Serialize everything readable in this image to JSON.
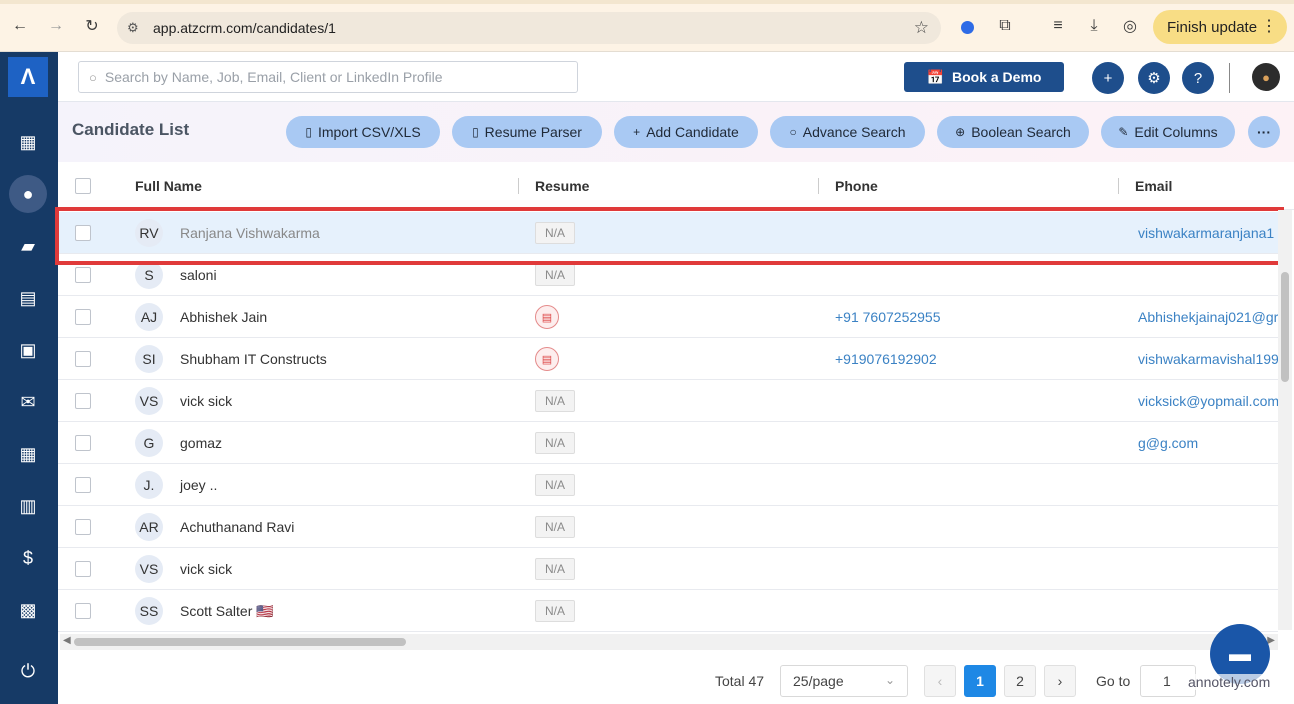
{
  "browser": {
    "url": "app.atzcrm.com/candidates/1",
    "finish_update_label": "Finish update"
  },
  "sidebar": {
    "logo_text": "Λ",
    "items": [
      {
        "name": "dashboard-icon",
        "glyph": "▦"
      },
      {
        "name": "candidates-icon",
        "glyph": "👤",
        "active": true
      },
      {
        "name": "jobs-icon",
        "glyph": "💼"
      },
      {
        "name": "clients-icon",
        "glyph": "🏬"
      },
      {
        "name": "contacts-icon",
        "glyph": "📇"
      },
      {
        "name": "mail-icon",
        "glyph": "✉"
      },
      {
        "name": "calendar-icon",
        "glyph": "📅"
      },
      {
        "name": "reports-icon",
        "glyph": "📊"
      },
      {
        "name": "billing-icon",
        "glyph": "$"
      },
      {
        "name": "payroll-icon",
        "glyph": "💵"
      },
      {
        "name": "logout-icon",
        "glyph": "⏻"
      }
    ]
  },
  "appbar": {
    "search_placeholder": "Search by Name, Job, Email, Client or LinkedIn Profile",
    "book_demo_label": "Book a Demo"
  },
  "toolbar": {
    "title": "Candidate List",
    "buttons": {
      "import": "Import CSV/XLS",
      "resume_parser": "Resume Parser",
      "add_candidate": "Add Candidate",
      "advance_search": "Advance Search",
      "boolean_search": "Boolean Search",
      "edit_columns": "Edit Columns"
    }
  },
  "table": {
    "columns": {
      "full_name": "Full Name",
      "resume": "Resume",
      "phone": "Phone",
      "email": "Email"
    },
    "na_label": "N/A",
    "rows": [
      {
        "initials": "RV",
        "name": "Ranjana Vishwakarma",
        "resume": "N/A",
        "phone": "",
        "email": "vishwakarmaranjana1"
      },
      {
        "initials": "S",
        "name": "saloni",
        "resume": "N/A",
        "phone": "",
        "email": ""
      },
      {
        "initials": "AJ",
        "name": "Abhishek Jain",
        "resume": "file",
        "phone": "+91 7607252955",
        "email": "Abhishekjainaj021@gr"
      },
      {
        "initials": "SI",
        "name": "Shubham IT Constructs",
        "resume": "file",
        "phone": "+919076192902",
        "email": "vishwakarmavishal199"
      },
      {
        "initials": "VS",
        "name": "vick sick",
        "resume": "N/A",
        "phone": "",
        "email": "vicksick@yopmail.com"
      },
      {
        "initials": "G",
        "name": "gomaz",
        "resume": "N/A",
        "phone": "",
        "email": "g@g.com"
      },
      {
        "initials": "J.",
        "name": "joey ..",
        "resume": "N/A",
        "phone": "",
        "email": ""
      },
      {
        "initials": "AR",
        "name": "Achuthanand Ravi",
        "resume": "N/A",
        "phone": "",
        "email": ""
      },
      {
        "initials": "VS",
        "name": "vick sick",
        "resume": "N/A",
        "phone": "",
        "email": ""
      },
      {
        "initials": "SS",
        "name": "Scott Salter 🇺🇸",
        "resume": "N/A",
        "phone": "",
        "email": ""
      }
    ]
  },
  "pagination": {
    "total_label": "Total 47",
    "page_size": "25/page",
    "pages": [
      "1",
      "2"
    ],
    "current_page": "1",
    "goto_label": "Go to",
    "goto_value": "1"
  },
  "watermark": "annotely.com"
}
